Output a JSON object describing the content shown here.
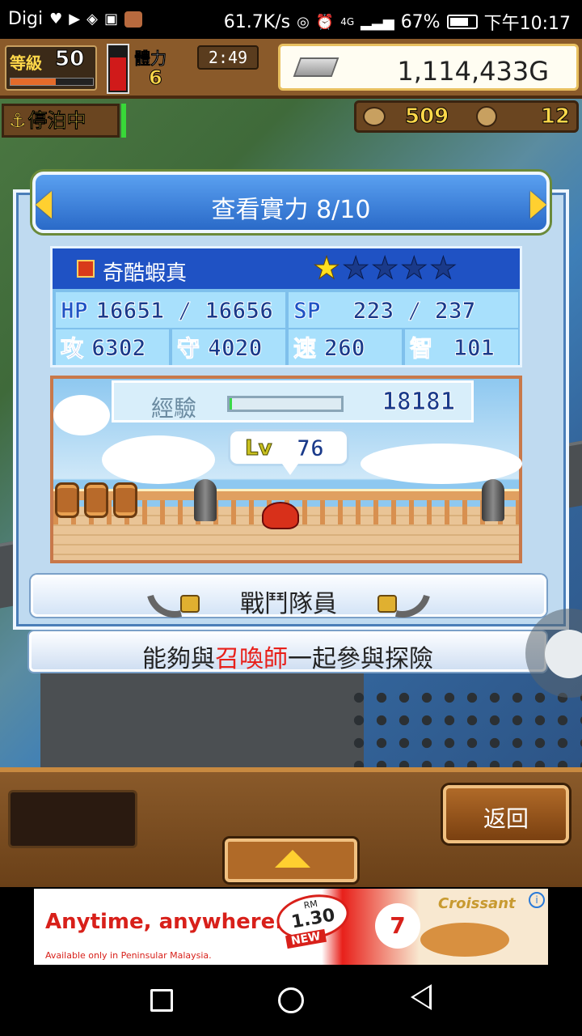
{
  "status_bar": {
    "carrier": "Digi",
    "net_speed": "61.7K/s",
    "network": "4G",
    "battery": "67%",
    "time": "下午10:17"
  },
  "hud": {
    "level_label": "等級",
    "level": "50",
    "level_progress": 0.55,
    "stamina_label": "體力",
    "stamina": "6",
    "timer": "2:49",
    "gold": "1,114,433G",
    "docked_label": "停泊中",
    "resource_1": "509",
    "resource_2": "12"
  },
  "dialog": {
    "title": "查看實力 8/10",
    "monster": {
      "name": "奇酷蝦真",
      "stars_filled": 1,
      "stars_total": 5,
      "hp_label": "HP",
      "hp": "16651 / 16656",
      "sp_label": "SP",
      "sp": "223 / 237",
      "atk_label": "攻",
      "atk": "6302",
      "def_label": "守",
      "def": "4020",
      "spd_label": "速",
      "spd": "260",
      "int_label": "智",
      "int": "101",
      "exp_label": "經驗",
      "exp": "18181",
      "exp_progress": 0.02,
      "lv_label": "Lv",
      "lv": "76"
    },
    "team_button": "戰鬥隊員",
    "summon_prefix": "能夠與",
    "summon_highlight": "召喚師",
    "summon_suffix": "一起參與探險"
  },
  "bottom": {
    "back_label": "返回"
  },
  "ad": {
    "headline": "Anytime, anywhere.",
    "subline": "Available only in Peninsular Malaysia.",
    "price_currency": "RM",
    "price": "1.30",
    "badge": "NEW",
    "logo": "7",
    "brand": "Croissant"
  },
  "colors": {
    "accent_blue": "#1f52c4",
    "gold_star": "#ffe020",
    "highlight_red": "#e8201a"
  }
}
